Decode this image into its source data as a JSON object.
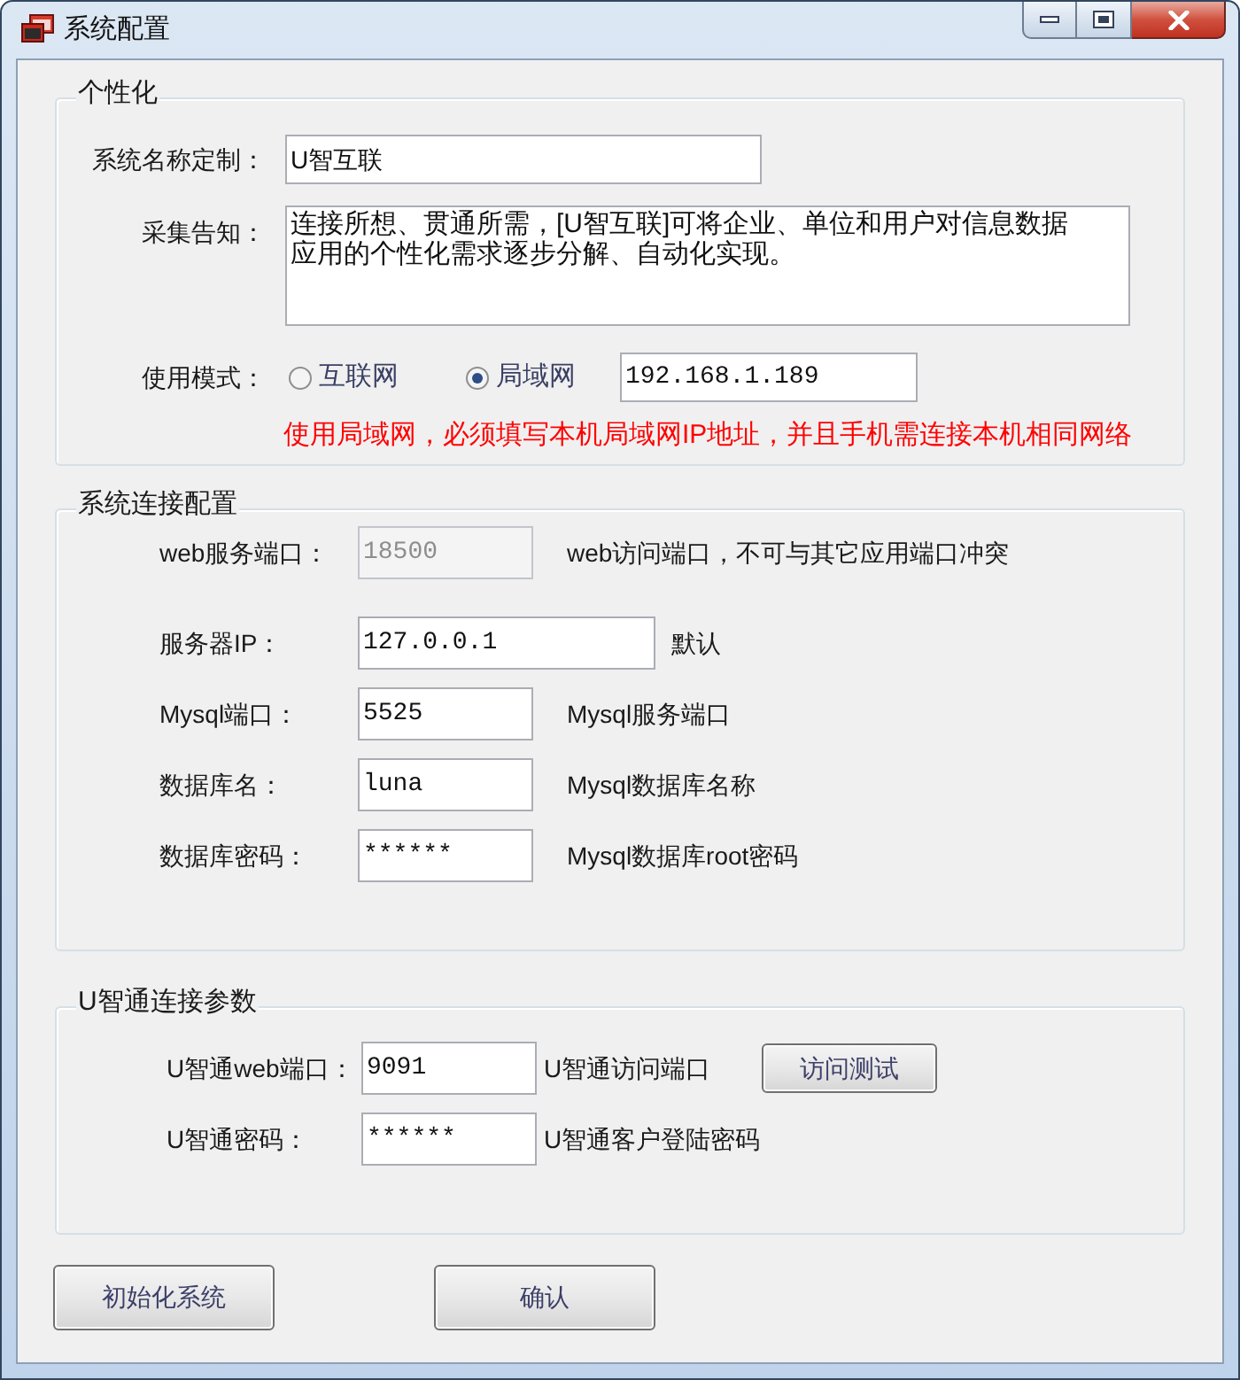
{
  "window": {
    "title": "系统配置"
  },
  "personalization": {
    "title": "个性化",
    "fields": [
      {
        "kind": "text",
        "label": "系统名称定制：",
        "value": "U智互联"
      },
      {
        "kind": "multiline",
        "label": "采集告知：",
        "value": "连接所想、贯通所需，[U智互联]可将企业、单位和用户对信息数据应用的个性化需求逐步分解、自动化实现。"
      },
      {
        "kind": "mode",
        "label": "使用模式：",
        "options": [
          {
            "label": "互联网",
            "selected": false
          },
          {
            "label": "局域网",
            "selected": true
          }
        ],
        "value": "192.168.1.189"
      }
    ],
    "warning": "使用局域网，必须填写本机局域网IP地址，并且手机需连接本机相同网络"
  },
  "connection": {
    "title": "系统连接配置",
    "rows": [
      {
        "label": "web服务端口：",
        "value": "18500",
        "disabled": true,
        "description": "web访问端口，不可与其它应用端口冲突"
      },
      {
        "label": "服务器IP：",
        "value": "127.0.0.1",
        "disabled": false,
        "description": "默认"
      },
      {
        "label": "Mysql端口：",
        "value": "5525",
        "disabled": false,
        "description": "Mysql服务端口"
      },
      {
        "label": "数据库名：",
        "value": "luna",
        "disabled": false,
        "description": "Mysql数据库名称"
      },
      {
        "label": "数据库密码：",
        "value": "******",
        "disabled": false,
        "description": "Mysql数据库root密码"
      }
    ]
  },
  "uzhitong": {
    "title": "U智通连接参数",
    "rows": [
      {
        "label": "U智通web端口：",
        "value": "9091",
        "description": "U智通访问端口",
        "button": "访问测试"
      },
      {
        "label": "U智通密码：",
        "value": "******",
        "description": "U智通客户登陆密码"
      }
    ]
  },
  "buttons": [
    "初始化系统",
    "确认"
  ]
}
